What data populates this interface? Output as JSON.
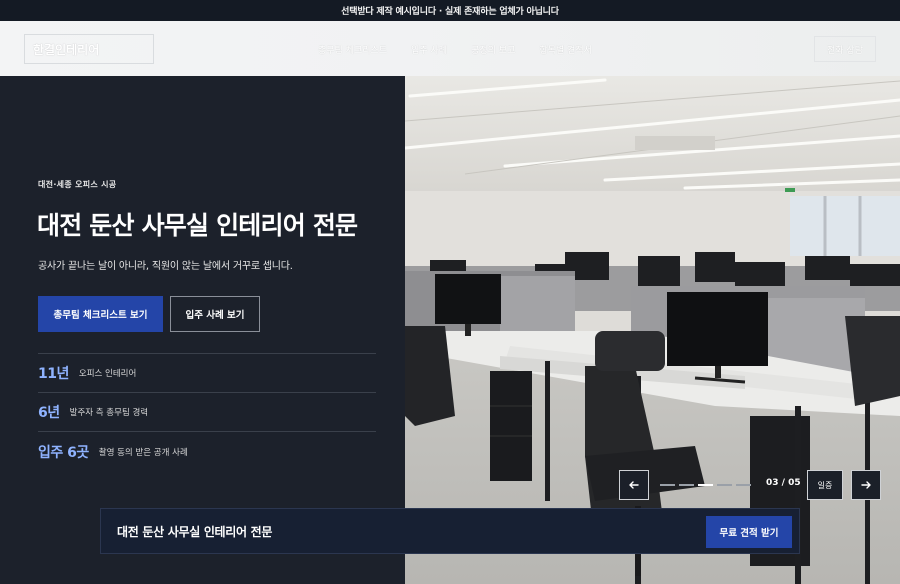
{
  "notice": "선택받다 제작 예시입니다 · 실제 존재하는 업체가 아닙니다",
  "header": {
    "logo": "한결인테리어",
    "nav": [
      "총무팀 체크리스트",
      "입주 사례",
      "공정의 보고",
      "항목별 견적서"
    ],
    "cta": "전화 상담"
  },
  "hero": {
    "eyebrow": "대전·세종 오피스 시공",
    "title": "대전 둔산 사무실 인테리어 전문",
    "subtitle": "공사가 끝나는 날이 아니라, 직원이 앉는 날에서 거꾸로 셉니다.",
    "primary_button": "총무팀 체크리스트 보기",
    "secondary_button": "입주 사례 보기",
    "stats": [
      {
        "num": "11년",
        "label": "오피스 인테리어"
      },
      {
        "num": "6년",
        "label": "발주자 측 총무팀 경력"
      },
      {
        "num": "입주 6곳",
        "label": "촬영 동의 받은 공개 사례"
      }
    ]
  },
  "slider": {
    "counter": "03 / 05",
    "pause": "일증",
    "current": 3,
    "total": 5
  },
  "cta_bar": {
    "title": "대전 둔산 사무실 인테리어 전문",
    "button": "무료 견적 받기"
  },
  "colors": {
    "accent": "#2445a8",
    "stat_number": "#8fb3ff",
    "dark_bg": "#1c212b"
  }
}
